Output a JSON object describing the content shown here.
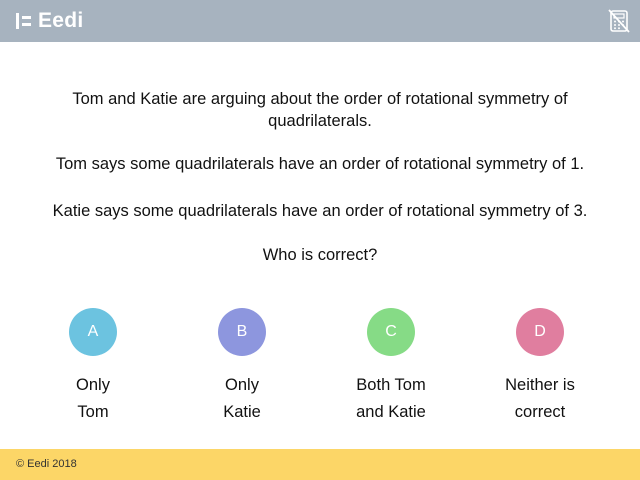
{
  "header": {
    "logo_text": "Eedi",
    "background": "#a7b3bf",
    "icons": [
      "eedi-logo-mark-icon",
      "calculator-not-allowed-icon"
    ]
  },
  "question": {
    "line1": "Tom and Katie are arguing about the order of rotational symmetry of quadrilaterals.",
    "line2": "Tom says some quadrilaterals have an order of rotational symmetry of 1.",
    "line3": "Katie says some quadrilaterals have an order of rotational symmetry of 3.",
    "line4": "Who is correct?"
  },
  "options": [
    {
      "letter": "A",
      "label": "Only Tom",
      "color": "#6cc3e0"
    },
    {
      "letter": "B",
      "label": "Only Katie",
      "color": "#8d96de"
    },
    {
      "letter": "C",
      "label": "Both Tom and Katie",
      "color": "#86db86"
    },
    {
      "letter": "D",
      "label": "Neither is correct",
      "color": "#e07e9f"
    }
  ],
  "footer": {
    "copyright": "© Eedi 2018",
    "background": "#fcd667"
  }
}
